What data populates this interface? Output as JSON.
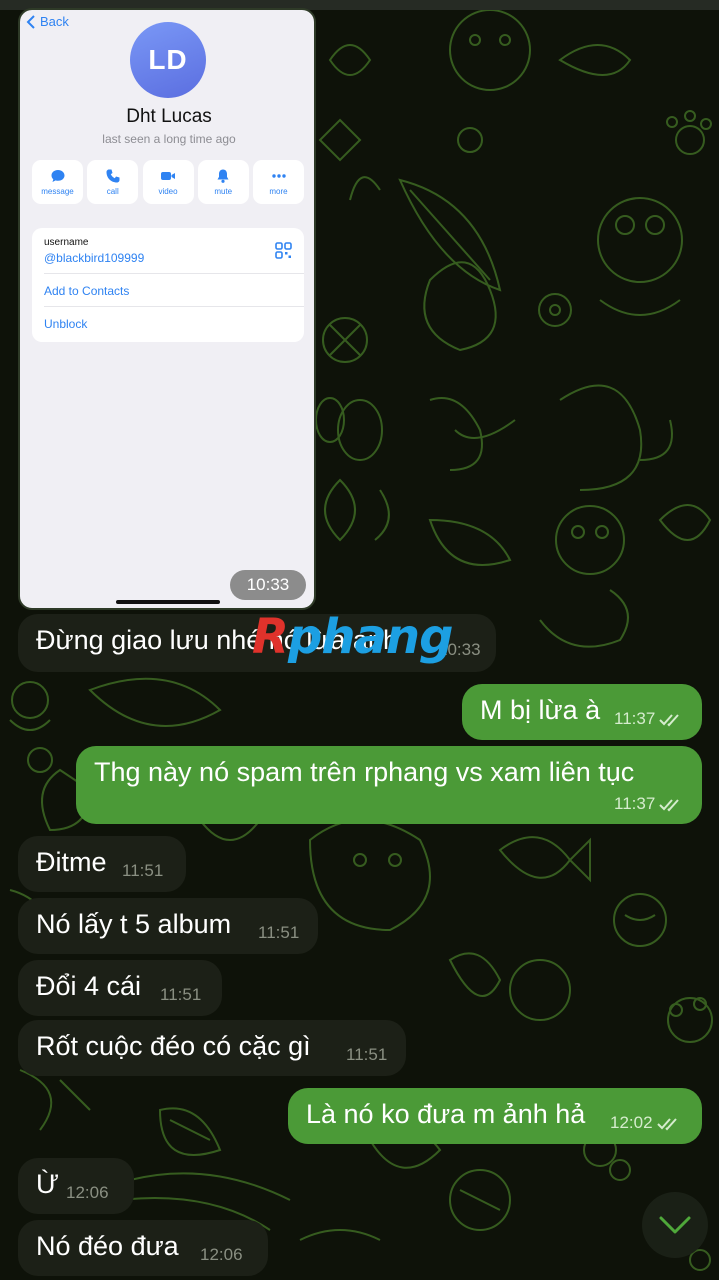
{
  "colors": {
    "incoming_bubble": "#1c2017",
    "outgoing_bubble": "#4b9a37",
    "doodle": "#3e6a24",
    "link_blue": "#2f83f2",
    "avatar": "#6d83ee"
  },
  "profile_shot": {
    "back_label": "Back",
    "avatar_initials": "LD",
    "name": "Dht Lucas",
    "status": "last seen a long time ago",
    "actions": [
      {
        "label": "message",
        "icon": "message-icon"
      },
      {
        "label": "call",
        "icon": "phone-icon"
      },
      {
        "label": "video",
        "icon": "video-icon"
      },
      {
        "label": "mute",
        "icon": "bell-icon"
      },
      {
        "label": "more",
        "icon": "more-icon"
      }
    ],
    "username_label": "username",
    "username_value": "@blackbird109999",
    "add_contact": "Add to Contacts",
    "unblock": "Unblock",
    "photo_time": "10:33"
  },
  "watermark": {
    "part1": "R",
    "part2": "phang"
  },
  "messages": [
    {
      "dir": "in",
      "text": "Đừng giao lưu nhé nó lừa anh",
      "time": "10:33"
    },
    {
      "dir": "out",
      "text": "M bị lừa à",
      "time": "11:37"
    },
    {
      "dir": "out",
      "text": "Thg này nó spam trên rphang vs xam liên tục",
      "time": "11:37"
    },
    {
      "dir": "in",
      "text": "Đitme",
      "time": "11:51"
    },
    {
      "dir": "in",
      "text": "Nó lấy t 5 album",
      "time": "11:51"
    },
    {
      "dir": "in",
      "text": "Đổi 4 cái",
      "time": "11:51"
    },
    {
      "dir": "in",
      "text": "Rốt cuộc đéo có cặc gì",
      "time": "11:51"
    },
    {
      "dir": "out",
      "text": "Là nó ko đưa m ảnh hả",
      "time": "12:02"
    },
    {
      "dir": "in",
      "text": "Ừ",
      "time": "12:06"
    },
    {
      "dir": "in",
      "text": "Nó đéo đưa",
      "time": "12:06"
    }
  ],
  "scroll_down_icon": "chevron-down-icon"
}
